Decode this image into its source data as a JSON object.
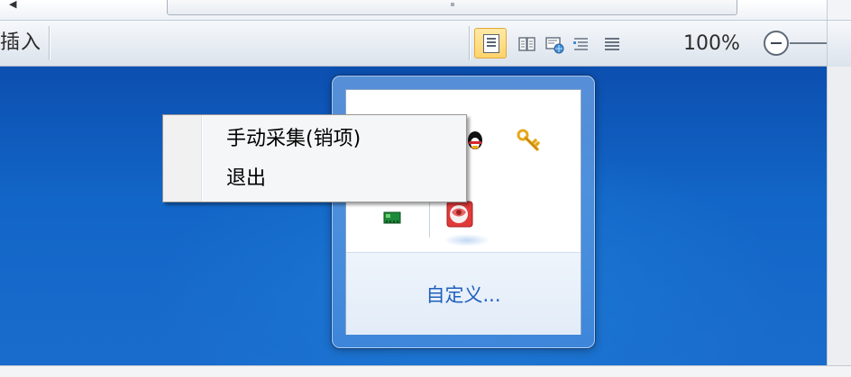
{
  "status_bar": {
    "insert_mode_label": "插入",
    "view_buttons": [
      "print-layout",
      "full-screen-reading",
      "web-layout",
      "outline",
      "draft"
    ],
    "active_view": "print-layout",
    "zoom_level": "100%"
  },
  "tray_flyout": {
    "icons": [
      "qq-penguin",
      "key-tool",
      "network-adapter",
      "security-shield"
    ],
    "customize_link": "自定义..."
  },
  "context_menu": {
    "items": [
      {
        "label": "手动采集(销项)"
      },
      {
        "label": "退出"
      }
    ]
  },
  "colors": {
    "desktop_blue": "#1266c7",
    "link_blue": "#1f5fbf",
    "active_view_gold": "#ffd36b"
  }
}
